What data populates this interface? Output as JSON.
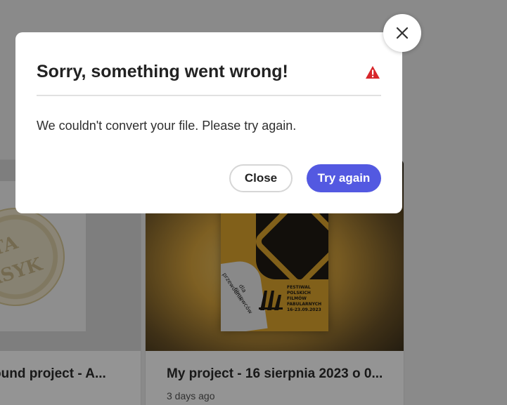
{
  "background_cards": [
    {
      "title": "ound project - A..."
    },
    {
      "title": "My project - 16 sierpnia 2023 o 0...",
      "date": "3 days ago"
    }
  ],
  "poster": {
    "left_text": "STA\nASYK",
    "side_text": "przewodnik dla filmowców",
    "festival_text": "FESTIWAL\nPOLSKICH\nFILMÓW\nFABULARNYCH\n16-23.09.2023"
  },
  "dialog": {
    "title": "Sorry, something went wrong!",
    "message": "We couldn't convert your file. Please try again.",
    "close_label": "Close",
    "try_again_label": "Try again",
    "alert_icon": "alert-triangle-icon",
    "dismiss_icon": "close-icon"
  },
  "colors": {
    "primary_button": "#5359e1",
    "alert": "#d7262a",
    "overlay": "rgba(0,0,0,0.42)"
  }
}
